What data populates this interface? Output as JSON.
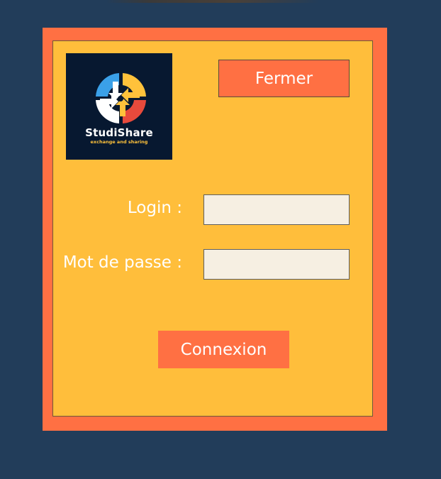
{
  "logo": {
    "name": "StudiShare",
    "tagline": "exchange and sharing",
    "icon": "four-arrows-circle-logo"
  },
  "buttons": {
    "close_label": "Fermer",
    "login_label": "Connexion"
  },
  "form": {
    "login_label": "Login :",
    "login_value": "",
    "password_label": "Mot de passe :",
    "password_value": ""
  },
  "colors": {
    "background": "#223d5a",
    "frame": "#ff7043",
    "panel": "#ffbe3b",
    "field": "#f6efe2",
    "logo_bg": "#071830"
  }
}
